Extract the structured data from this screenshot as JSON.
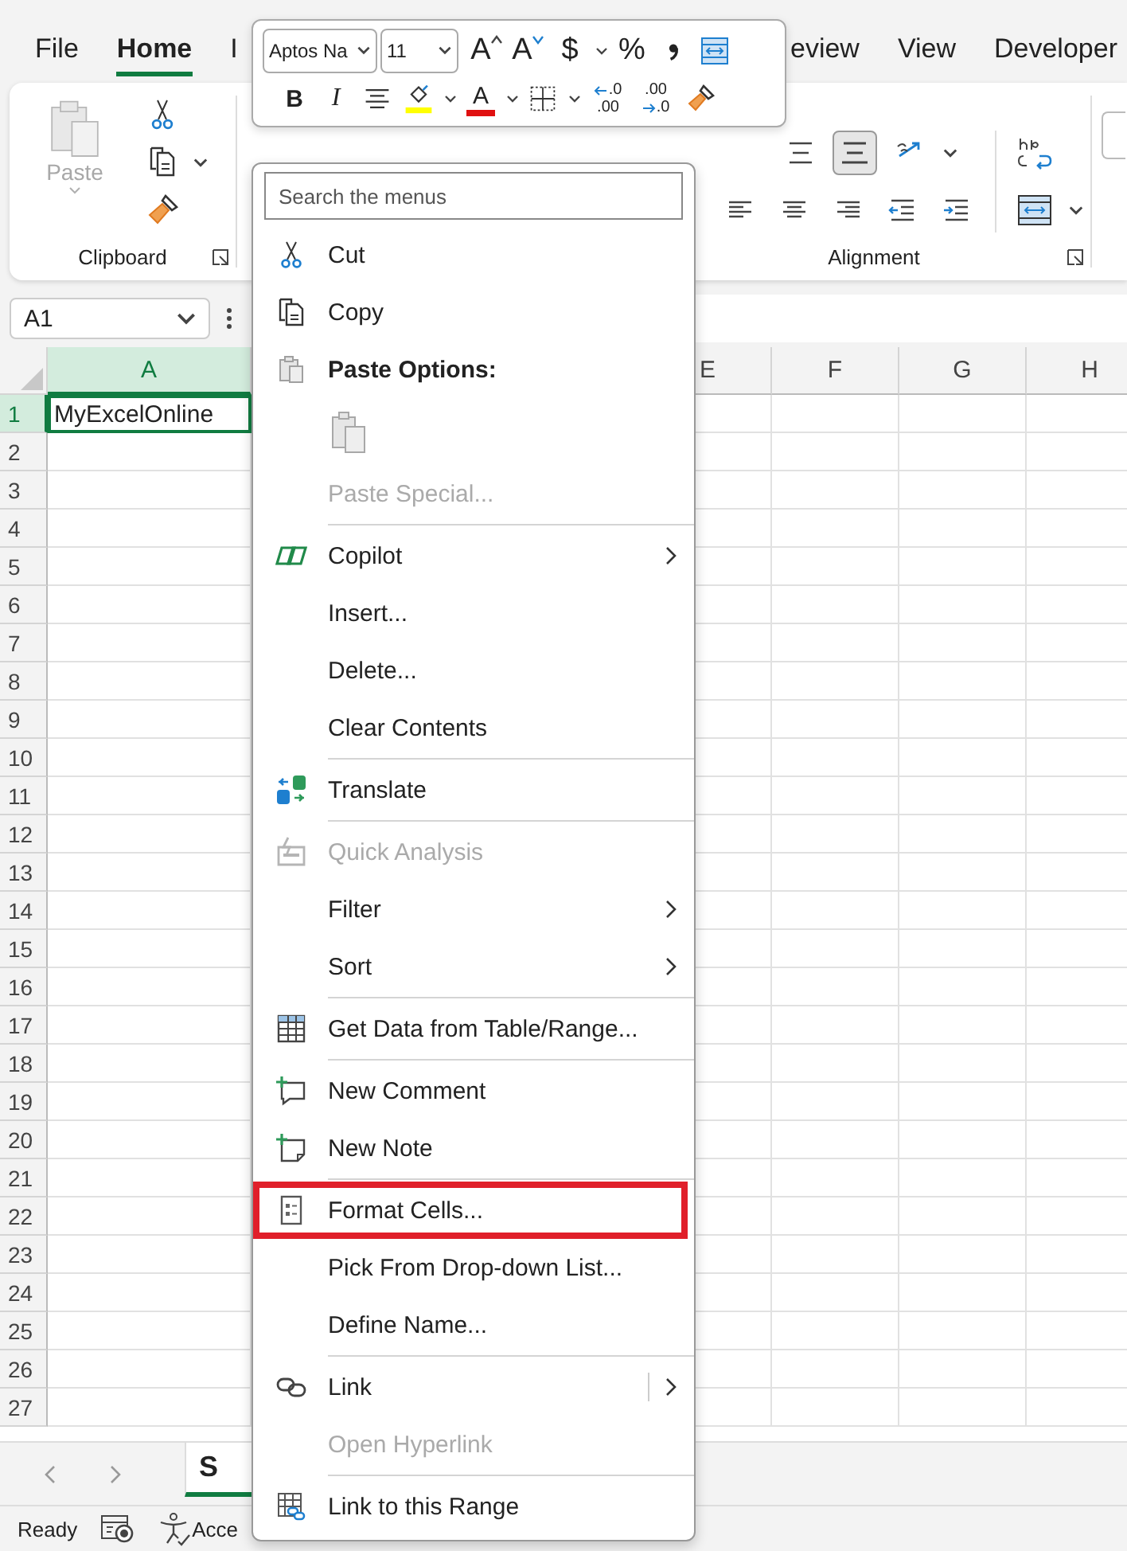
{
  "ribbon_tabs": [
    {
      "label": "File",
      "selected": false
    },
    {
      "label": "Home",
      "selected": true
    },
    {
      "label": "I",
      "selected": false
    },
    {
      "label": "eview",
      "selected": false
    },
    {
      "label": "View",
      "selected": false
    },
    {
      "label": "Developer",
      "selected": false
    }
  ],
  "mini_toolbar": {
    "font": "Aptos Na",
    "size": "11",
    "row1": [
      {
        "kind": "grow",
        "label": "A"
      },
      {
        "kind": "shrink",
        "label": "A"
      },
      {
        "kind": "glyph",
        "label": "$"
      },
      {
        "kind": "dropdown"
      },
      {
        "kind": "glyph",
        "label": "%"
      },
      {
        "kind": "comma"
      },
      {
        "kind": "wrap"
      }
    ],
    "row2": [
      {
        "kind": "bold",
        "label": "B"
      },
      {
        "kind": "italic",
        "label": "I"
      },
      {
        "kind": "align"
      },
      {
        "kind": "fill"
      },
      {
        "kind": "dropdown"
      },
      {
        "kind": "font-color",
        "label": "A"
      },
      {
        "kind": "dropdown"
      },
      {
        "kind": "borders"
      },
      {
        "kind": "dropdown"
      },
      {
        "kind": "increase-decimal",
        "top": ".0",
        "bottom": ".00"
      },
      {
        "kind": "decrease-decimal",
        "top": ".00",
        "bottom": ".0"
      },
      {
        "kind": "painter"
      }
    ]
  },
  "ribbon": {
    "clipboard": {
      "paste": {
        "label": "Paste",
        "disabled": true
      },
      "label": "Clipboard"
    },
    "alignment": {
      "label": "Alignment",
      "top_row": [
        {
          "kind": "middle-align",
          "selected": false
        },
        {
          "kind": "bottom-align",
          "selected": true
        },
        {
          "kind": "orientation",
          "selected": false
        }
      ],
      "bottom_row": [
        {
          "kind": "align-left"
        },
        {
          "kind": "align-center"
        },
        {
          "kind": "align-right"
        },
        {
          "kind": "decrease-indent"
        },
        {
          "kind": "increase-indent"
        }
      ]
    }
  },
  "formula_bar": {
    "name_box": "A1"
  },
  "grid": {
    "columns": [
      {
        "label": "A",
        "selected": true
      },
      {
        "label": "E",
        "selected": false
      },
      {
        "label": "F",
        "selected": false
      },
      {
        "label": "G",
        "selected": false
      },
      {
        "label": "H",
        "selected": false
      }
    ],
    "rows": [
      {
        "label": "1",
        "selected": true
      },
      {
        "label": "2",
        "selected": false
      },
      {
        "label": "3",
        "selected": false
      },
      {
        "label": "4",
        "selected": false
      },
      {
        "label": "5",
        "selected": false
      },
      {
        "label": "6",
        "selected": false
      },
      {
        "label": "7",
        "selected": false
      },
      {
        "label": "8",
        "selected": false
      },
      {
        "label": "9",
        "selected": false
      },
      {
        "label": "10",
        "selected": false
      },
      {
        "label": "11",
        "selected": false
      },
      {
        "label": "12",
        "selected": false
      },
      {
        "label": "13",
        "selected": false
      },
      {
        "label": "14",
        "selected": false
      },
      {
        "label": "15",
        "selected": false
      },
      {
        "label": "16",
        "selected": false
      },
      {
        "label": "17",
        "selected": false
      },
      {
        "label": "18",
        "selected": false
      },
      {
        "label": "19",
        "selected": false
      },
      {
        "label": "20",
        "selected": false
      },
      {
        "label": "21",
        "selected": false
      },
      {
        "label": "22",
        "selected": false
      },
      {
        "label": "23",
        "selected": false
      },
      {
        "label": "24",
        "selected": false
      },
      {
        "label": "25",
        "selected": false
      },
      {
        "label": "26",
        "selected": false
      },
      {
        "label": "27",
        "selected": false
      }
    ],
    "active_cell": {
      "value": "MyExcelOnline"
    }
  },
  "sheet_tabs": [
    {
      "label": "S",
      "selected": true
    }
  ],
  "status_bar": {
    "mode": "Ready",
    "accessibility": "Acce"
  },
  "context_menu": {
    "search_placeholder": "Search the menus",
    "items": [
      {
        "kind": "cut",
        "label": "Cut",
        "disabled": false,
        "submenu": false,
        "highlighted": false
      },
      {
        "kind": "copy",
        "label": "Copy",
        "disabled": false,
        "submenu": false,
        "highlighted": false
      },
      {
        "kind": "header",
        "label": "Paste Options:"
      },
      {
        "kind": "paste-options"
      },
      {
        "kind": "plain",
        "label": "Paste Special...",
        "disabled": true,
        "submenu": false,
        "highlighted": false
      },
      {
        "kind": "separator"
      },
      {
        "kind": "copilot",
        "label": "Copilot",
        "disabled": false,
        "submenu": true,
        "highlighted": false
      },
      {
        "kind": "plain",
        "label": "Insert...",
        "disabled": false,
        "submenu": false,
        "highlighted": false
      },
      {
        "kind": "plain",
        "label": "Delete...",
        "disabled": false,
        "submenu": false,
        "highlighted": false
      },
      {
        "kind": "plain",
        "label": "Clear Contents",
        "disabled": false,
        "submenu": false,
        "highlighted": false
      },
      {
        "kind": "separator"
      },
      {
        "kind": "translate",
        "label": "Translate",
        "disabled": false,
        "submenu": false,
        "highlighted": false
      },
      {
        "kind": "separator"
      },
      {
        "kind": "quick-analysis",
        "label": "Quick Analysis",
        "disabled": true,
        "submenu": false,
        "highlighted": false
      },
      {
        "kind": "plain",
        "label": "Filter",
        "disabled": false,
        "submenu": true,
        "highlighted": false
      },
      {
        "kind": "plain",
        "label": "Sort",
        "disabled": false,
        "submenu": true,
        "highlighted": false
      },
      {
        "kind": "separator"
      },
      {
        "kind": "table",
        "label": "Get Data from Table/Range...",
        "disabled": false,
        "submenu": false,
        "highlighted": false
      },
      {
        "kind": "separator"
      },
      {
        "kind": "comment",
        "label": "New Comment",
        "disabled": false,
        "submenu": false,
        "highlighted": false
      },
      {
        "kind": "note",
        "label": "New Note",
        "disabled": false,
        "submenu": false,
        "highlighted": false
      },
      {
        "kind": "separator"
      },
      {
        "kind": "format",
        "label": "Format Cells...",
        "disabled": false,
        "submenu": false,
        "highlighted": true
      },
      {
        "kind": "plain",
        "label": "Pick From Drop-down List...",
        "disabled": false,
        "submenu": false,
        "highlighted": false
      },
      {
        "kind": "plain",
        "label": "Define Name...",
        "disabled": false,
        "submenu": false,
        "highlighted": false
      },
      {
        "kind": "separator"
      },
      {
        "kind": "link",
        "label": "Link",
        "disabled": false,
        "submenu": true,
        "highlighted": false
      },
      {
        "kind": "plain",
        "label": "Open Hyperlink",
        "disabled": true,
        "submenu": false,
        "highlighted": false
      },
      {
        "kind": "separator"
      },
      {
        "kind": "link-range",
        "label": "Link to this Range",
        "disabled": false,
        "submenu": false,
        "highlighted": false
      }
    ]
  }
}
